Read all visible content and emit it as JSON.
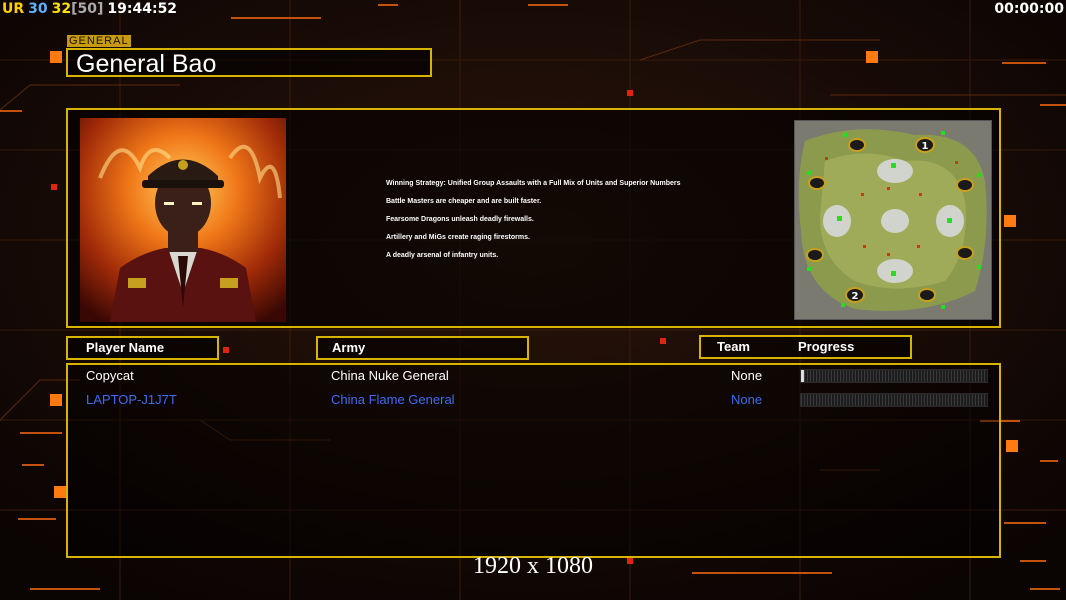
{
  "hud": {
    "ur_label": "UR",
    "fps": "30",
    "logic_fps": "32",
    "logic_cap": "[50]",
    "clock": "19:44:52",
    "game_timer": "00:00:00"
  },
  "general": {
    "tag": "GENERAL",
    "name": "General Bao"
  },
  "strategy": {
    "lines": [
      "Winning Strategy: Unified Group Assaults with a Full Mix of Units and Superior Numbers",
      "Battle Masters are cheaper and are built faster.",
      "Fearsome Dragons unleash deadly firewalls.",
      "Artillery and MiGs create raging firestorms.",
      "A deadly arsenal of infantry units."
    ]
  },
  "minimap": {
    "start_positions": [
      "1",
      "2"
    ]
  },
  "table": {
    "headers": {
      "player_name": "Player Name",
      "army": "Army",
      "team": "Team",
      "progress": "Progress"
    },
    "rows": [
      {
        "name": "Copycat",
        "army": "China Nuke General",
        "team": "None",
        "progress": 0.01,
        "color": "#ffffff"
      },
      {
        "name": "LAPTOP-J1J7T",
        "army": "China Flame General",
        "team": "None",
        "progress": 0,
        "color": "#3f6cf0"
      }
    ]
  },
  "resolution": "1920 x 1080",
  "colors": {
    "panel_border": "#d8b400",
    "hud_ur": "#ffd000",
    "hud_fps": "#5fb0ff",
    "hud_logic": "#ffe000",
    "hud_cap": "#aaaaaa"
  }
}
